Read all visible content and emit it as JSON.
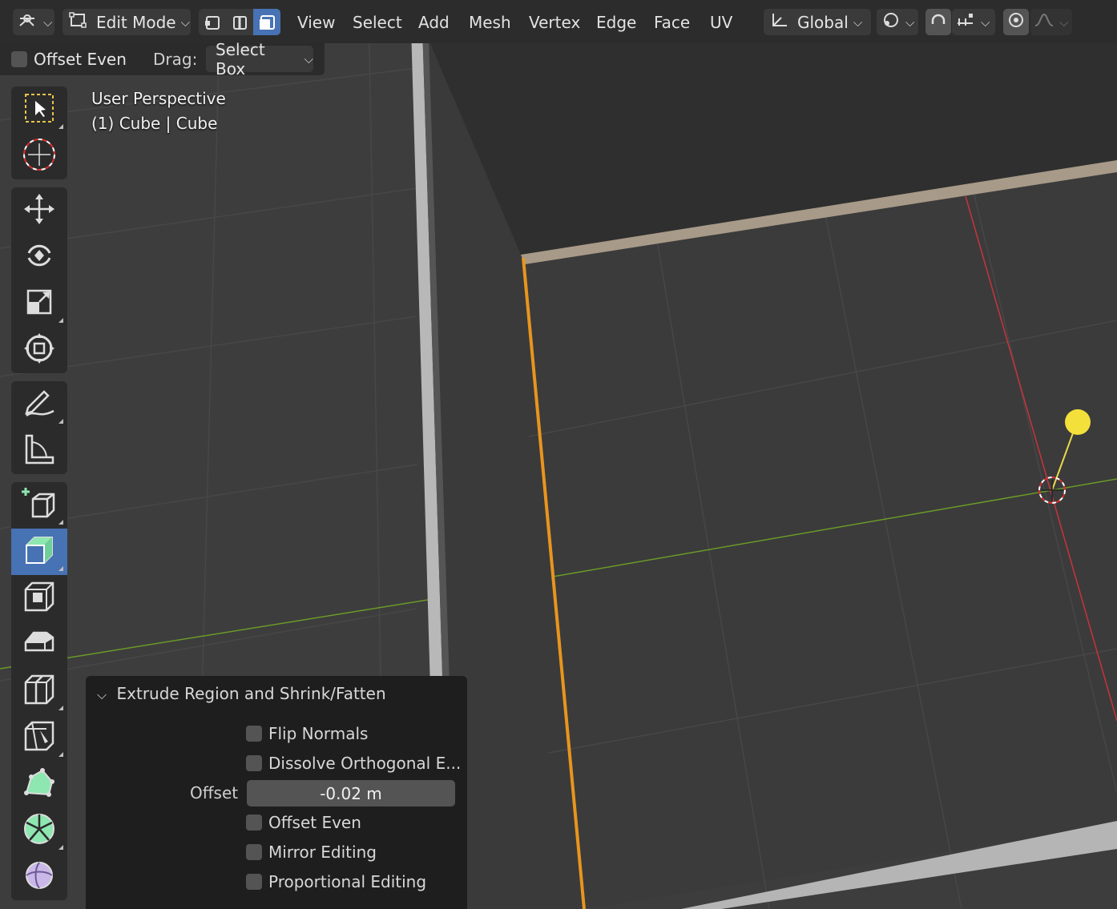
{
  "header": {
    "mode_label": "Edit Mode",
    "menus": [
      "View",
      "Select",
      "Add",
      "Mesh",
      "Vertex",
      "Edge",
      "Face",
      "UV"
    ],
    "orientation_label": "Global",
    "select_modes": [
      "vertex-select",
      "edge-select",
      "face-select"
    ],
    "active_select_mode": "face-select"
  },
  "tool_settings": {
    "offset_even_label": "Offset Even",
    "drag_label": "Drag:",
    "drag_value": "Select Box"
  },
  "viewport": {
    "view_name": "User Perspective",
    "object_info": "(1) Cube | Cube",
    "colors": {
      "x_axis": "#c8343c",
      "y_axis": "#6a9a28",
      "selection": "#e8951e",
      "light": "#f4e03a"
    }
  },
  "toolbar": {
    "tools": [
      "select-box",
      "cursor",
      "move",
      "rotate",
      "scale",
      "transform",
      "annotate",
      "measure",
      "add-cube",
      "extrude-region",
      "inset-faces",
      "bevel",
      "loop-cut",
      "knife",
      "poly-build",
      "spin",
      "smooth"
    ],
    "active_tool": "extrude-region"
  },
  "operator_panel": {
    "title": "Extrude Region and Shrink/Fatten",
    "flip_normals_label": "Flip Normals",
    "dissolve_label": "Dissolve Orthogonal E...",
    "offset_label": "Offset",
    "offset_value": "-0.02 m",
    "offset_even_label": "Offset Even",
    "mirror_label": "Mirror Editing",
    "proportional_label": "Proportional Editing"
  }
}
